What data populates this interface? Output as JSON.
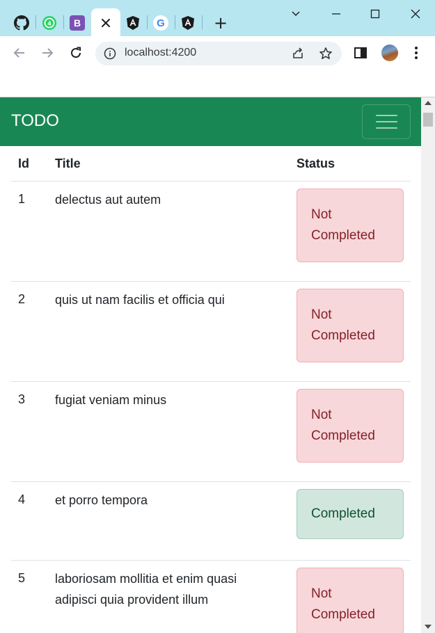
{
  "browser": {
    "tabs": [
      {
        "icon": "github-icon"
      },
      {
        "icon": "whatsapp-icon"
      },
      {
        "icon": "bootstrap-icon",
        "glyph": "B"
      },
      {
        "icon": "close-icon",
        "active": true
      },
      {
        "icon": "angular-icon"
      },
      {
        "icon": "google-icon",
        "glyph": "G"
      },
      {
        "icon": "angular-icon"
      }
    ],
    "new_tab_glyph": "+",
    "url": "localhost:4200"
  },
  "app": {
    "brand": "TODO",
    "colors": {
      "navbar": "#198754",
      "danger_bg": "#f8d7da",
      "danger_text": "#842029",
      "success_bg": "#d1e7dd",
      "success_text": "#0f5132"
    },
    "table": {
      "headers": [
        "Id",
        "Title",
        "Status"
      ],
      "rows": [
        {
          "id": "1",
          "title": "delectus aut autem",
          "status": "Not Completed",
          "completed": false
        },
        {
          "id": "2",
          "title": "quis ut nam facilis et officia qui",
          "status": "Not Completed",
          "completed": false
        },
        {
          "id": "3",
          "title": "fugiat veniam minus",
          "status": "Not Completed",
          "completed": false
        },
        {
          "id": "4",
          "title": "et porro tempora",
          "status": "Completed",
          "completed": true
        },
        {
          "id": "5",
          "title": "laboriosam mollitia et enim quasi adipisci quia provident illum",
          "status": "Not Completed",
          "completed": false
        }
      ]
    }
  }
}
